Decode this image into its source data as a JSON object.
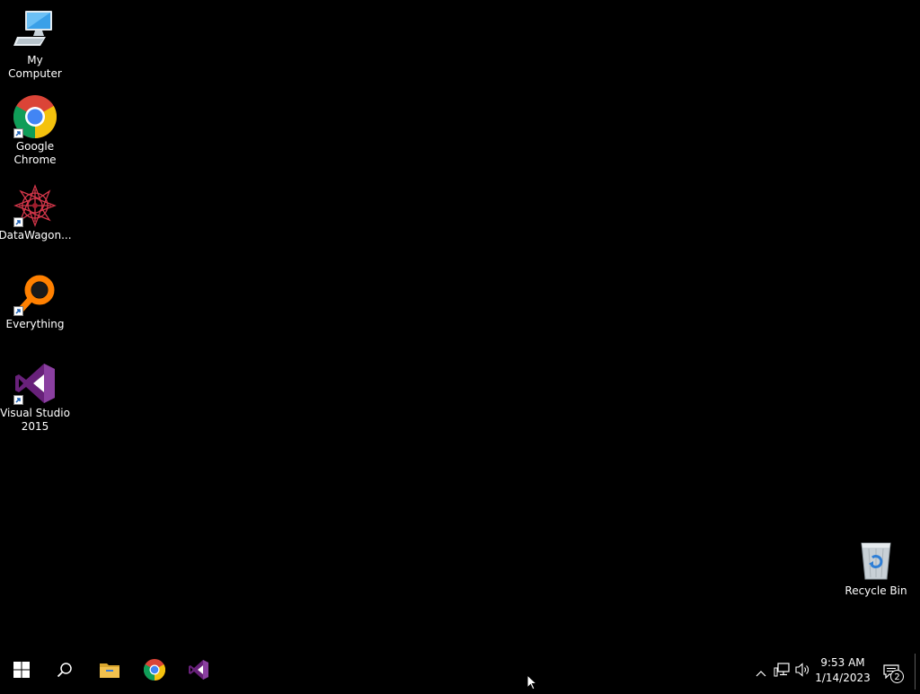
{
  "desktop": {
    "icons": [
      {
        "label": "My Computer",
        "icon": "computer-icon"
      },
      {
        "label": "Google\nChrome",
        "icon": "chrome-icon"
      },
      {
        "label": "DataWagon...",
        "icon": "datawagon-icon"
      },
      {
        "label": "Everything",
        "icon": "everything-search-icon"
      },
      {
        "label": "Visual Studio\n2015",
        "icon": "visual-studio-icon"
      },
      {
        "label": "Recycle Bin",
        "icon": "recycle-bin-icon"
      }
    ]
  },
  "taskbar": {
    "pinned": [
      {
        "name": "start",
        "icon": "windows-logo-icon"
      },
      {
        "name": "search",
        "icon": "search-icon"
      },
      {
        "name": "file-explorer",
        "icon": "folder-icon"
      },
      {
        "name": "chrome",
        "icon": "chrome-icon"
      },
      {
        "name": "visual-studio",
        "icon": "visual-studio-icon"
      }
    ],
    "tray": {
      "time": "9:53 AM",
      "date": "1/14/2023",
      "notification_count": "2"
    }
  },
  "colors": {
    "background": "#000000",
    "text": "#ffffff",
    "vs_purple": "#68217a",
    "everything_orange": "#ff8000",
    "folder_yellow": "#f2c14e"
  }
}
